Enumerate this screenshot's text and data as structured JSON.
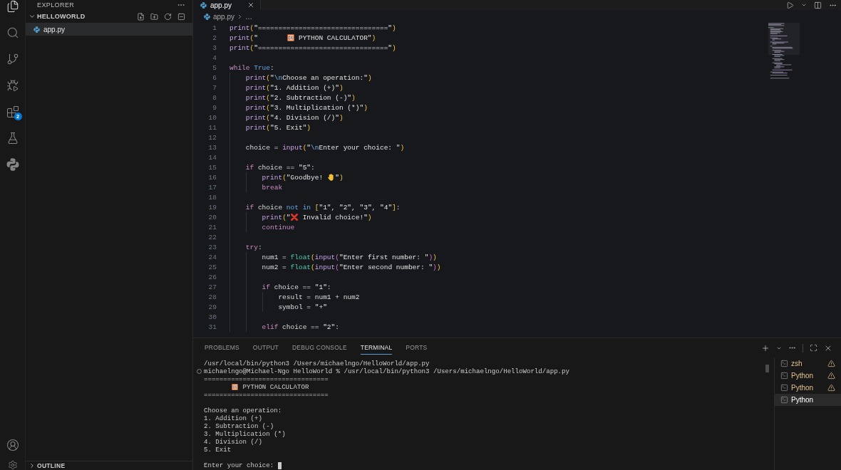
{
  "activity_bar": {
    "items": [
      {
        "kind": "files",
        "selected": true
      },
      {
        "kind": "search",
        "selected": false
      },
      {
        "kind": "branch",
        "selected": false
      },
      {
        "kind": "debug",
        "selected": false
      },
      {
        "kind": "extensions",
        "selected": false,
        "badge": "2"
      },
      {
        "kind": "flask",
        "selected": false
      },
      {
        "kind": "python",
        "selected": false
      }
    ],
    "bottom_items": [
      {
        "kind": "account"
      },
      {
        "kind": "settings"
      }
    ]
  },
  "sidebar": {
    "title": "EXPLORER",
    "folder": {
      "name": "HELLOWORLD",
      "expanded": true,
      "children": [
        {
          "name": "app.py",
          "selected": true
        }
      ]
    },
    "outline": {
      "title": "OUTLINE",
      "expanded": false
    }
  },
  "editor": {
    "tabs": [
      {
        "label": "app.py",
        "selected": true
      }
    ],
    "breadcrumb": [
      "app.py",
      "…"
    ],
    "lines": [
      {
        "number": "1",
        "tokens": [
          {
            "text": "print",
            "kind": "call"
          },
          {
            "text": "(",
            "kind": "bracket"
          },
          {
            "text": "\"================================\"",
            "kind": "string"
          },
          {
            "text": ")",
            "kind": "bracket"
          }
        ]
      },
      {
        "number": "2",
        "tokens": [
          {
            "text": "print",
            "kind": "call"
          },
          {
            "text": "(",
            "kind": "bracket"
          },
          {
            "text": "\"       ",
            "kind": "string"
          },
          {
            "kind": "abacus"
          },
          {
            "text": " PYTHON CALCULATOR\"",
            "kind": "string"
          },
          {
            "text": ")",
            "kind": "bracket"
          }
        ]
      },
      {
        "number": "3",
        "tokens": [
          {
            "text": "print",
            "kind": "call"
          },
          {
            "text": "(",
            "kind": "bracket"
          },
          {
            "text": "\"================================\"",
            "kind": "string"
          },
          {
            "text": ")",
            "kind": "bracket"
          }
        ]
      },
      {
        "number": "4"
      },
      {
        "number": "5",
        "tokens": [
          {
            "text": "while",
            "kind": "keyword"
          },
          {
            "text": " True",
            "kind": "constant"
          },
          {
            "text": ":",
            "kind": "plain"
          }
        ]
      },
      {
        "number": "6",
        "tokens": [
          {
            "text": "    print",
            "kind": "call"
          },
          {
            "text": "(",
            "kind": "bracket"
          },
          {
            "text": "\"",
            "kind": "string"
          },
          {
            "text": "\\n",
            "kind": "escape"
          },
          {
            "text": "Choose an operation:\"",
            "kind": "string"
          },
          {
            "text": ")",
            "kind": "bracket"
          }
        ]
      },
      {
        "number": "7",
        "tokens": [
          {
            "text": "    print",
            "kind": "call"
          },
          {
            "text": "(",
            "kind": "bracket"
          },
          {
            "text": "\"1. Addition (+)\"",
            "kind": "string"
          },
          {
            "text": ")",
            "kind": "bracket"
          }
        ]
      },
      {
        "number": "8",
        "tokens": [
          {
            "text": "    print",
            "kind": "call"
          },
          {
            "text": "(",
            "kind": "bracket"
          },
          {
            "text": "\"2. Subtraction (-)\"",
            "kind": "string"
          },
          {
            "text": ")",
            "kind": "bracket"
          }
        ]
      },
      {
        "number": "9",
        "tokens": [
          {
            "text": "    print",
            "kind": "call"
          },
          {
            "text": "(",
            "kind": "bracket"
          },
          {
            "text": "\"3. Multiplication (*)\"",
            "kind": "string"
          },
          {
            "text": ")",
            "kind": "bracket"
          }
        ]
      },
      {
        "number": "10",
        "tokens": [
          {
            "text": "    print",
            "kind": "call"
          },
          {
            "text": "(",
            "kind": "bracket"
          },
          {
            "text": "\"4. Division (/)\"",
            "kind": "string"
          },
          {
            "text": ")",
            "kind": "bracket"
          }
        ]
      },
      {
        "number": "11",
        "tokens": [
          {
            "text": "    print",
            "kind": "call"
          },
          {
            "text": "(",
            "kind": "bracket"
          },
          {
            "text": "\"5. Exit\"",
            "kind": "string"
          },
          {
            "text": ")",
            "kind": "bracket"
          }
        ]
      },
      {
        "number": "12"
      },
      {
        "number": "13",
        "tokens": [
          {
            "text": "    choice = ",
            "kind": "plain"
          },
          {
            "text": "input",
            "kind": "call"
          },
          {
            "text": "(",
            "kind": "bracket"
          },
          {
            "text": "\"",
            "kind": "string"
          },
          {
            "text": "\\n",
            "kind": "escape"
          },
          {
            "text": "Enter your choice: \"",
            "kind": "string"
          },
          {
            "text": ")",
            "kind": "bracket"
          }
        ]
      },
      {
        "number": "14"
      },
      {
        "number": "15",
        "tokens": [
          {
            "text": "    if",
            "kind": "keyword"
          },
          {
            "text": " choice == ",
            "kind": "plain"
          },
          {
            "text": "\"5\"",
            "kind": "string"
          },
          {
            "text": ":",
            "kind": "plain"
          }
        ]
      },
      {
        "number": "16",
        "tokens": [
          {
            "text": "        print",
            "kind": "call"
          },
          {
            "text": "(",
            "kind": "bracket"
          },
          {
            "text": "\"Goodbye! ",
            "kind": "string"
          },
          {
            "kind": "hand"
          },
          {
            "text": "\"",
            "kind": "string"
          },
          {
            "text": ")",
            "kind": "bracket"
          }
        ]
      },
      {
        "number": "17",
        "tokens": [
          {
            "text": "        break",
            "kind": "keyword"
          }
        ]
      },
      {
        "number": "18"
      },
      {
        "number": "19",
        "tokens": [
          {
            "text": "    if",
            "kind": "keyword"
          },
          {
            "text": " choice ",
            "kind": "plain"
          },
          {
            "text": "not",
            "kind": "operator"
          },
          {
            "text": " in",
            "kind": "operator"
          },
          {
            "text": " [",
            "kind": "bracket"
          },
          {
            "text": "\"1\"",
            "kind": "string"
          },
          {
            "text": ", ",
            "kind": "plain"
          },
          {
            "text": "\"2\"",
            "kind": "string"
          },
          {
            "text": ", ",
            "kind": "plain"
          },
          {
            "text": "\"3\"",
            "kind": "string"
          },
          {
            "text": ", ",
            "kind": "plain"
          },
          {
            "text": "\"4\"",
            "kind": "string"
          },
          {
            "text": "]",
            "kind": "bracket"
          },
          {
            "text": ":",
            "kind": "plain"
          }
        ]
      },
      {
        "number": "20",
        "tokens": [
          {
            "text": "        print",
            "kind": "call"
          },
          {
            "text": "(",
            "kind": "bracket"
          },
          {
            "text": "\"",
            "kind": "string"
          },
          {
            "kind": "cross"
          },
          {
            "text": " Invalid choice!\"",
            "kind": "string"
          },
          {
            "text": ")",
            "kind": "bracket"
          }
        ]
      },
      {
        "number": "21",
        "tokens": [
          {
            "text": "        continue",
            "kind": "keyword"
          }
        ]
      },
      {
        "number": "22"
      },
      {
        "number": "23",
        "tokens": [
          {
            "text": "    try",
            "kind": "keyword"
          },
          {
            "text": ":",
            "kind": "plain"
          }
        ]
      },
      {
        "number": "24",
        "tokens": [
          {
            "text": "        num1 = ",
            "kind": "plain"
          },
          {
            "text": "float",
            "kind": "class"
          },
          {
            "text": "(",
            "kind": "bracket"
          },
          {
            "text": "input",
            "kind": "call"
          },
          {
            "text": "(",
            "kind": "bracket2"
          },
          {
            "text": "\"Enter first number: \"",
            "kind": "string"
          },
          {
            "text": ")",
            "kind": "bracket2"
          },
          {
            "text": ")",
            "kind": "bracket"
          }
        ]
      },
      {
        "number": "25",
        "tokens": [
          {
            "text": "        num2 = ",
            "kind": "plain"
          },
          {
            "text": "float",
            "kind": "class"
          },
          {
            "text": "(",
            "kind": "bracket"
          },
          {
            "text": "input",
            "kind": "call"
          },
          {
            "text": "(",
            "kind": "bracket2"
          },
          {
            "text": "\"Enter second number: \"",
            "kind": "string"
          },
          {
            "text": ")",
            "kind": "bracket2"
          },
          {
            "text": ")",
            "kind": "bracket"
          }
        ]
      },
      {
        "number": "26"
      },
      {
        "number": "27",
        "tokens": [
          {
            "text": "        if",
            "kind": "keyword"
          },
          {
            "text": " choice == ",
            "kind": "plain"
          },
          {
            "text": "\"1\"",
            "kind": "string"
          },
          {
            "text": ":",
            "kind": "plain"
          }
        ]
      },
      {
        "number": "28",
        "tokens": [
          {
            "text": "            result = num1 + num2",
            "kind": "plain"
          }
        ]
      },
      {
        "number": "29",
        "tokens": [
          {
            "text": "            symbol = ",
            "kind": "plain"
          },
          {
            "text": "\"+\"",
            "kind": "string"
          }
        ]
      },
      {
        "number": "30"
      },
      {
        "number": "31",
        "tokens": [
          {
            "text": "        elif",
            "kind": "keyword"
          },
          {
            "text": " choice == ",
            "kind": "plain"
          },
          {
            "text": "\"2\"",
            "kind": "string"
          },
          {
            "text": ":",
            "kind": "plain"
          }
        ]
      }
    ]
  },
  "panel": {
    "tabs": [
      {
        "label": "PROBLEMS",
        "selected": false
      },
      {
        "label": "OUTPUT",
        "selected": false
      },
      {
        "label": "DEBUG CONSOLE",
        "selected": false
      },
      {
        "label": "TERMINAL",
        "selected": true
      },
      {
        "label": "PORTS",
        "selected": false
      }
    ],
    "terminal": {
      "lines": [
        {
          "kind": "output",
          "tokens": [
            {
              "text": "/usr/local/bin/python3 /Users/michaelngo/HelloWorld/app.py",
              "kind": "text"
            }
          ]
        },
        {
          "kind": "command",
          "tokens": [
            {
              "text": "michaelngo@Michael-Ngo HelloWorld % /usr/local/bin/python3 /Users/michaelngo/HelloWorld/app.py",
              "kind": "text"
            }
          ]
        },
        {
          "kind": "output",
          "tokens": [
            {
              "text": "================================",
              "kind": "text"
            }
          ]
        },
        {
          "kind": "indented",
          "tokens": [
            {
              "kind": "abacus"
            },
            {
              "text": " PYTHON CALCULATOR",
              "kind": "text"
            }
          ]
        },
        {
          "kind": "output",
          "tokens": [
            {
              "text": "================================",
              "kind": "text"
            }
          ]
        },
        {
          "kind": "blank"
        },
        {
          "kind": "output",
          "tokens": [
            {
              "text": "Choose an operation:",
              "kind": "text"
            }
          ]
        },
        {
          "kind": "output",
          "tokens": [
            {
              "text": "1. Addition (+)",
              "kind": "text"
            }
          ]
        },
        {
          "kind": "output",
          "tokens": [
            {
              "text": "2. Subtraction (-)",
              "kind": "text"
            }
          ]
        },
        {
          "kind": "output",
          "tokens": [
            {
              "text": "3. Multiplication (*)",
              "kind": "text"
            }
          ]
        },
        {
          "kind": "output",
          "tokens": [
            {
              "text": "4. Division (/)",
              "kind": "text"
            }
          ]
        },
        {
          "kind": "output",
          "tokens": [
            {
              "text": "5. Exit",
              "kind": "text"
            }
          ]
        },
        {
          "kind": "blank"
        },
        {
          "kind": "output",
          "tokens": [
            {
              "text": "Enter your choice: ",
              "kind": "text"
            },
            {
              "kind": "cursor"
            }
          ]
        }
      ]
    },
    "sessions": [
      {
        "name": "zsh",
        "selected": false,
        "warning": true
      },
      {
        "name": "Python",
        "selected": false,
        "warning": true
      },
      {
        "name": "Python",
        "selected": false,
        "warning": true
      },
      {
        "name": "Python",
        "selected": true,
        "warning": false
      }
    ]
  }
}
